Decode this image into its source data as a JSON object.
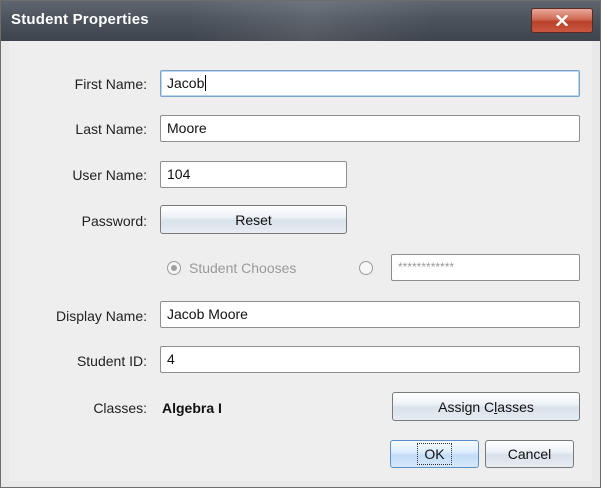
{
  "window": {
    "title": "Student Properties",
    "close_symbol": "×",
    "close_icon": "close-icon"
  },
  "form": {
    "first_name": {
      "label": "First Name:",
      "value": "Jacob"
    },
    "last_name": {
      "label": "Last Name:",
      "value": "Moore"
    },
    "user_name": {
      "label": "User Name:",
      "value": "104"
    },
    "password": {
      "label": "Password:",
      "reset_button": "Reset",
      "option_student_chooses": "Student Chooses",
      "option_student_chooses_selected": true,
      "option_custom_selected": false,
      "masked_value": "************"
    },
    "display_name": {
      "label": "Display Name:",
      "value": "Jacob Moore"
    },
    "student_id": {
      "label": "Student ID:",
      "value": "4"
    },
    "classes": {
      "label": "Classes:",
      "value": "Algebra I",
      "assign_button": {
        "before": "Assign C",
        "mnemonic": "l",
        "after": "asses"
      }
    }
  },
  "footer": {
    "ok_button": "OK",
    "cancel_button": "Cancel"
  },
  "colors": {
    "titlebar": "#4c535c",
    "close_button": "#c9573e",
    "default_button_border": "#5c8fc6",
    "dialog_background": "#eeeeee"
  }
}
